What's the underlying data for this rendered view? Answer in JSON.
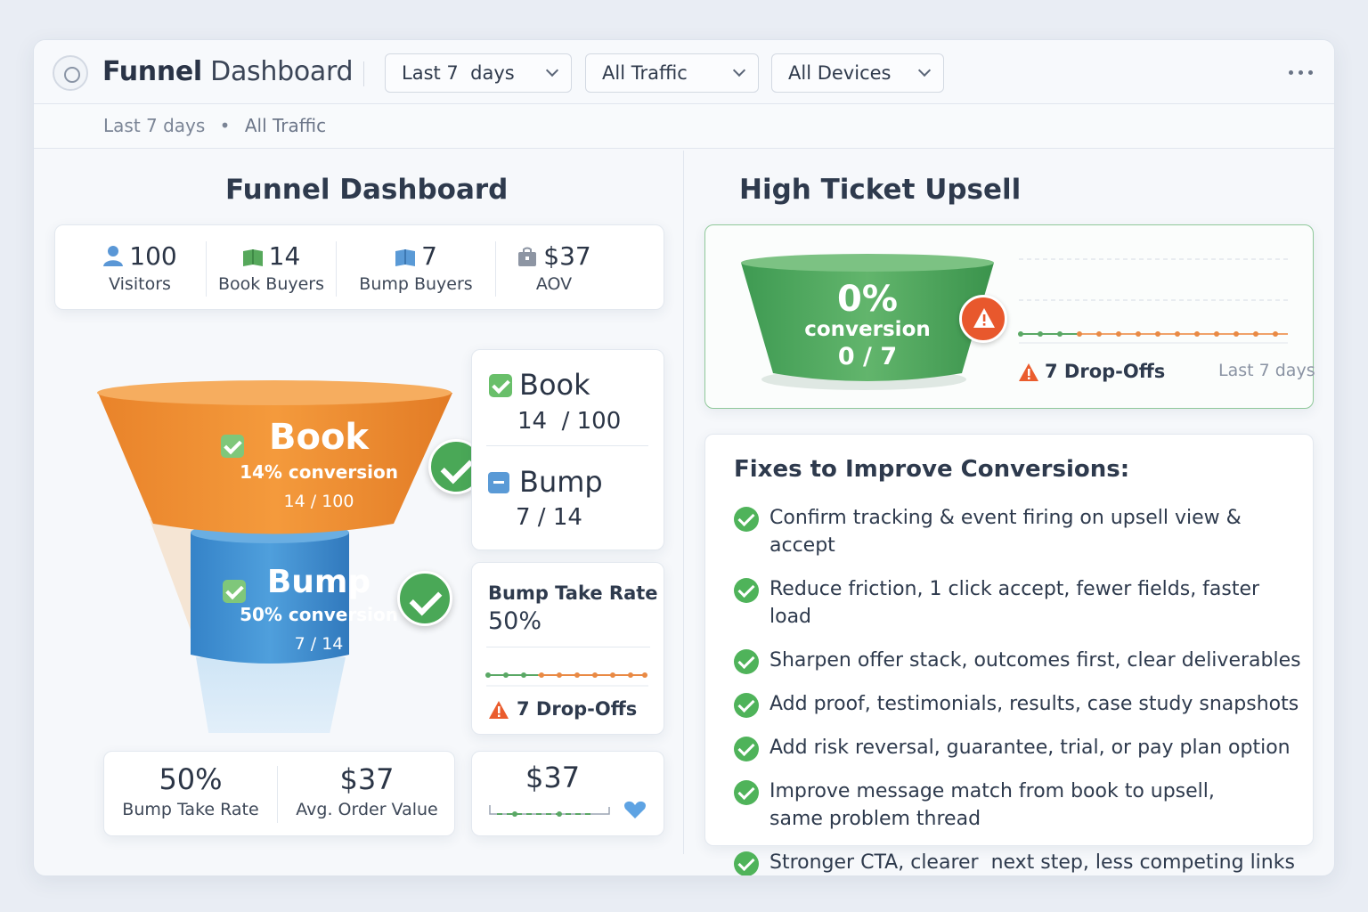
{
  "header": {
    "title_bold": "Funnel",
    "title_rest": "Dashboard",
    "filters": [
      {
        "value": "Last 7  days"
      },
      {
        "value": "All Traffic"
      },
      {
        "value": "All Devices"
      }
    ]
  },
  "breadcrumb": {
    "range": "Last 7 days",
    "separator": "•",
    "traffic": "All Traffic"
  },
  "left": {
    "title": "Funnel Dashboard",
    "stats": [
      {
        "value": "100",
        "label": "Visitors",
        "icon": "user-icon"
      },
      {
        "value": "14",
        "label": "Book Buyers",
        "icon": "book-icon"
      },
      {
        "value": "7",
        "label": "Bump Buyers",
        "icon": "bump-icon"
      },
      {
        "value": "$37",
        "label": "AOV",
        "icon": "bag-icon"
      }
    ],
    "funnel": {
      "book": {
        "title": "Book",
        "conversion": "14% conversion",
        "ratio": "14 / 100"
      },
      "bump": {
        "title": "Bump",
        "conversion": "50% conversion",
        "ratio": "7 / 14"
      }
    },
    "side": {
      "book_title": "Book",
      "book_ratio": "14  / 100",
      "bump_title": "Bump",
      "bump_ratio": "7 / 14",
      "take_rate_title": "Bump Take Rate",
      "take_rate_value": "50%",
      "dropoffs": "7 Drop-Offs",
      "aov_value": "$37"
    },
    "bottom": {
      "take_rate_value": "50%",
      "take_rate_label": "Bump Take Rate",
      "aov_value": "$37",
      "aov_label": "Avg. Order Value"
    }
  },
  "right": {
    "title": "High Ticket Upsell",
    "upsell": {
      "percent": "0%",
      "conversion": "conversion",
      "ratio": "0 / 7",
      "dropoffs": "7 Drop-Offs",
      "range": "Last 7 days"
    },
    "fixes_title": "Fixes to Improve Conversions:",
    "fixes": [
      "Confirm tracking & event firing on upsell view & accept",
      "Reduce friction, 1 click accept, fewer fields, faster load",
      "Sharpen offer stack, outcomes first, clear deliverables",
      "Add proof, testimonials, results, case study snapshots",
      "Add risk reversal, guarantee, trial, or pay plan option",
      "Improve message match from book to upsell, same problem thread",
      "Stronger CTA, clearer  next step, less competing links"
    ]
  },
  "colors": {
    "orange": "#f0912f",
    "blue": "#3f8fd0",
    "green": "#4aa857",
    "warning": "#e8582d"
  }
}
